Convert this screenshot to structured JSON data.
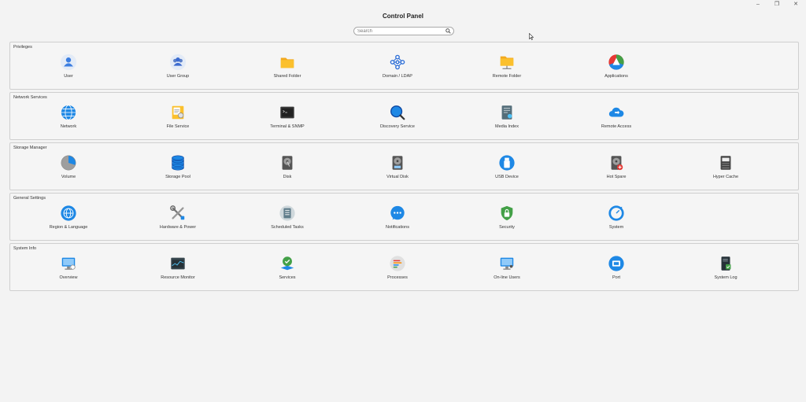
{
  "window": {
    "title": "Control Panel",
    "controls": [
      "–",
      "❐",
      "✕"
    ]
  },
  "search": {
    "placeholder": "Search"
  },
  "sections": [
    {
      "title": "Privileges",
      "items": [
        {
          "label": "User",
          "icon": "user-icon"
        },
        {
          "label": "User Group",
          "icon": "user-group-icon"
        },
        {
          "label": "Shared Folder",
          "icon": "shared-folder-icon"
        },
        {
          "label": "Domain / LDAP",
          "icon": "domain-ldap-icon"
        },
        {
          "label": "Remote Folder",
          "icon": "remote-folder-icon"
        },
        {
          "label": "Applications",
          "icon": "applications-icon"
        }
      ]
    },
    {
      "title": "Network Services",
      "items": [
        {
          "label": "Network",
          "icon": "network-globe-icon"
        },
        {
          "label": "File Service",
          "icon": "file-service-icon"
        },
        {
          "label": "Terminal & SNMP",
          "icon": "terminal-icon"
        },
        {
          "label": "Discovery Service",
          "icon": "discovery-search-icon"
        },
        {
          "label": "Media Index",
          "icon": "media-index-icon"
        },
        {
          "label": "Remote Access",
          "icon": "remote-access-cloud-icon"
        }
      ]
    },
    {
      "title": "Storage Manager",
      "items": [
        {
          "label": "Volume",
          "icon": "volume-pie-icon"
        },
        {
          "label": "Storage Pool",
          "icon": "storage-pool-icon"
        },
        {
          "label": "Disk",
          "icon": "disk-icon"
        },
        {
          "label": "Virtual Disk",
          "icon": "virtual-disk-icon"
        },
        {
          "label": "USB Device",
          "icon": "usb-device-icon"
        },
        {
          "label": "Hot Spare",
          "icon": "hot-spare-disk-icon"
        },
        {
          "label": "Hyper Cache",
          "icon": "hyper-cache-icon"
        }
      ]
    },
    {
      "title": "General Settings",
      "items": [
        {
          "label": "Region & Language",
          "icon": "region-globe-icon"
        },
        {
          "label": "Hardware & Power",
          "icon": "hardware-tools-icon"
        },
        {
          "label": "Scheduled Tasks",
          "icon": "scheduled-tasks-icon"
        },
        {
          "label": "Notifications",
          "icon": "notifications-chat-icon"
        },
        {
          "label": "Security",
          "icon": "security-lock-icon"
        },
        {
          "label": "System",
          "icon": "system-gauge-icon"
        }
      ]
    },
    {
      "title": "System Info",
      "items": [
        {
          "label": "Overview",
          "icon": "overview-monitor-icon"
        },
        {
          "label": "Resource Monitor",
          "icon": "resource-monitor-icon"
        },
        {
          "label": "Services",
          "icon": "services-check-icon"
        },
        {
          "label": "Processes",
          "icon": "processes-icon"
        },
        {
          "label": "On-line Users",
          "icon": "online-users-icon"
        },
        {
          "label": "Port",
          "icon": "port-icon"
        },
        {
          "label": "System Log",
          "icon": "system-log-icon"
        }
      ]
    }
  ]
}
